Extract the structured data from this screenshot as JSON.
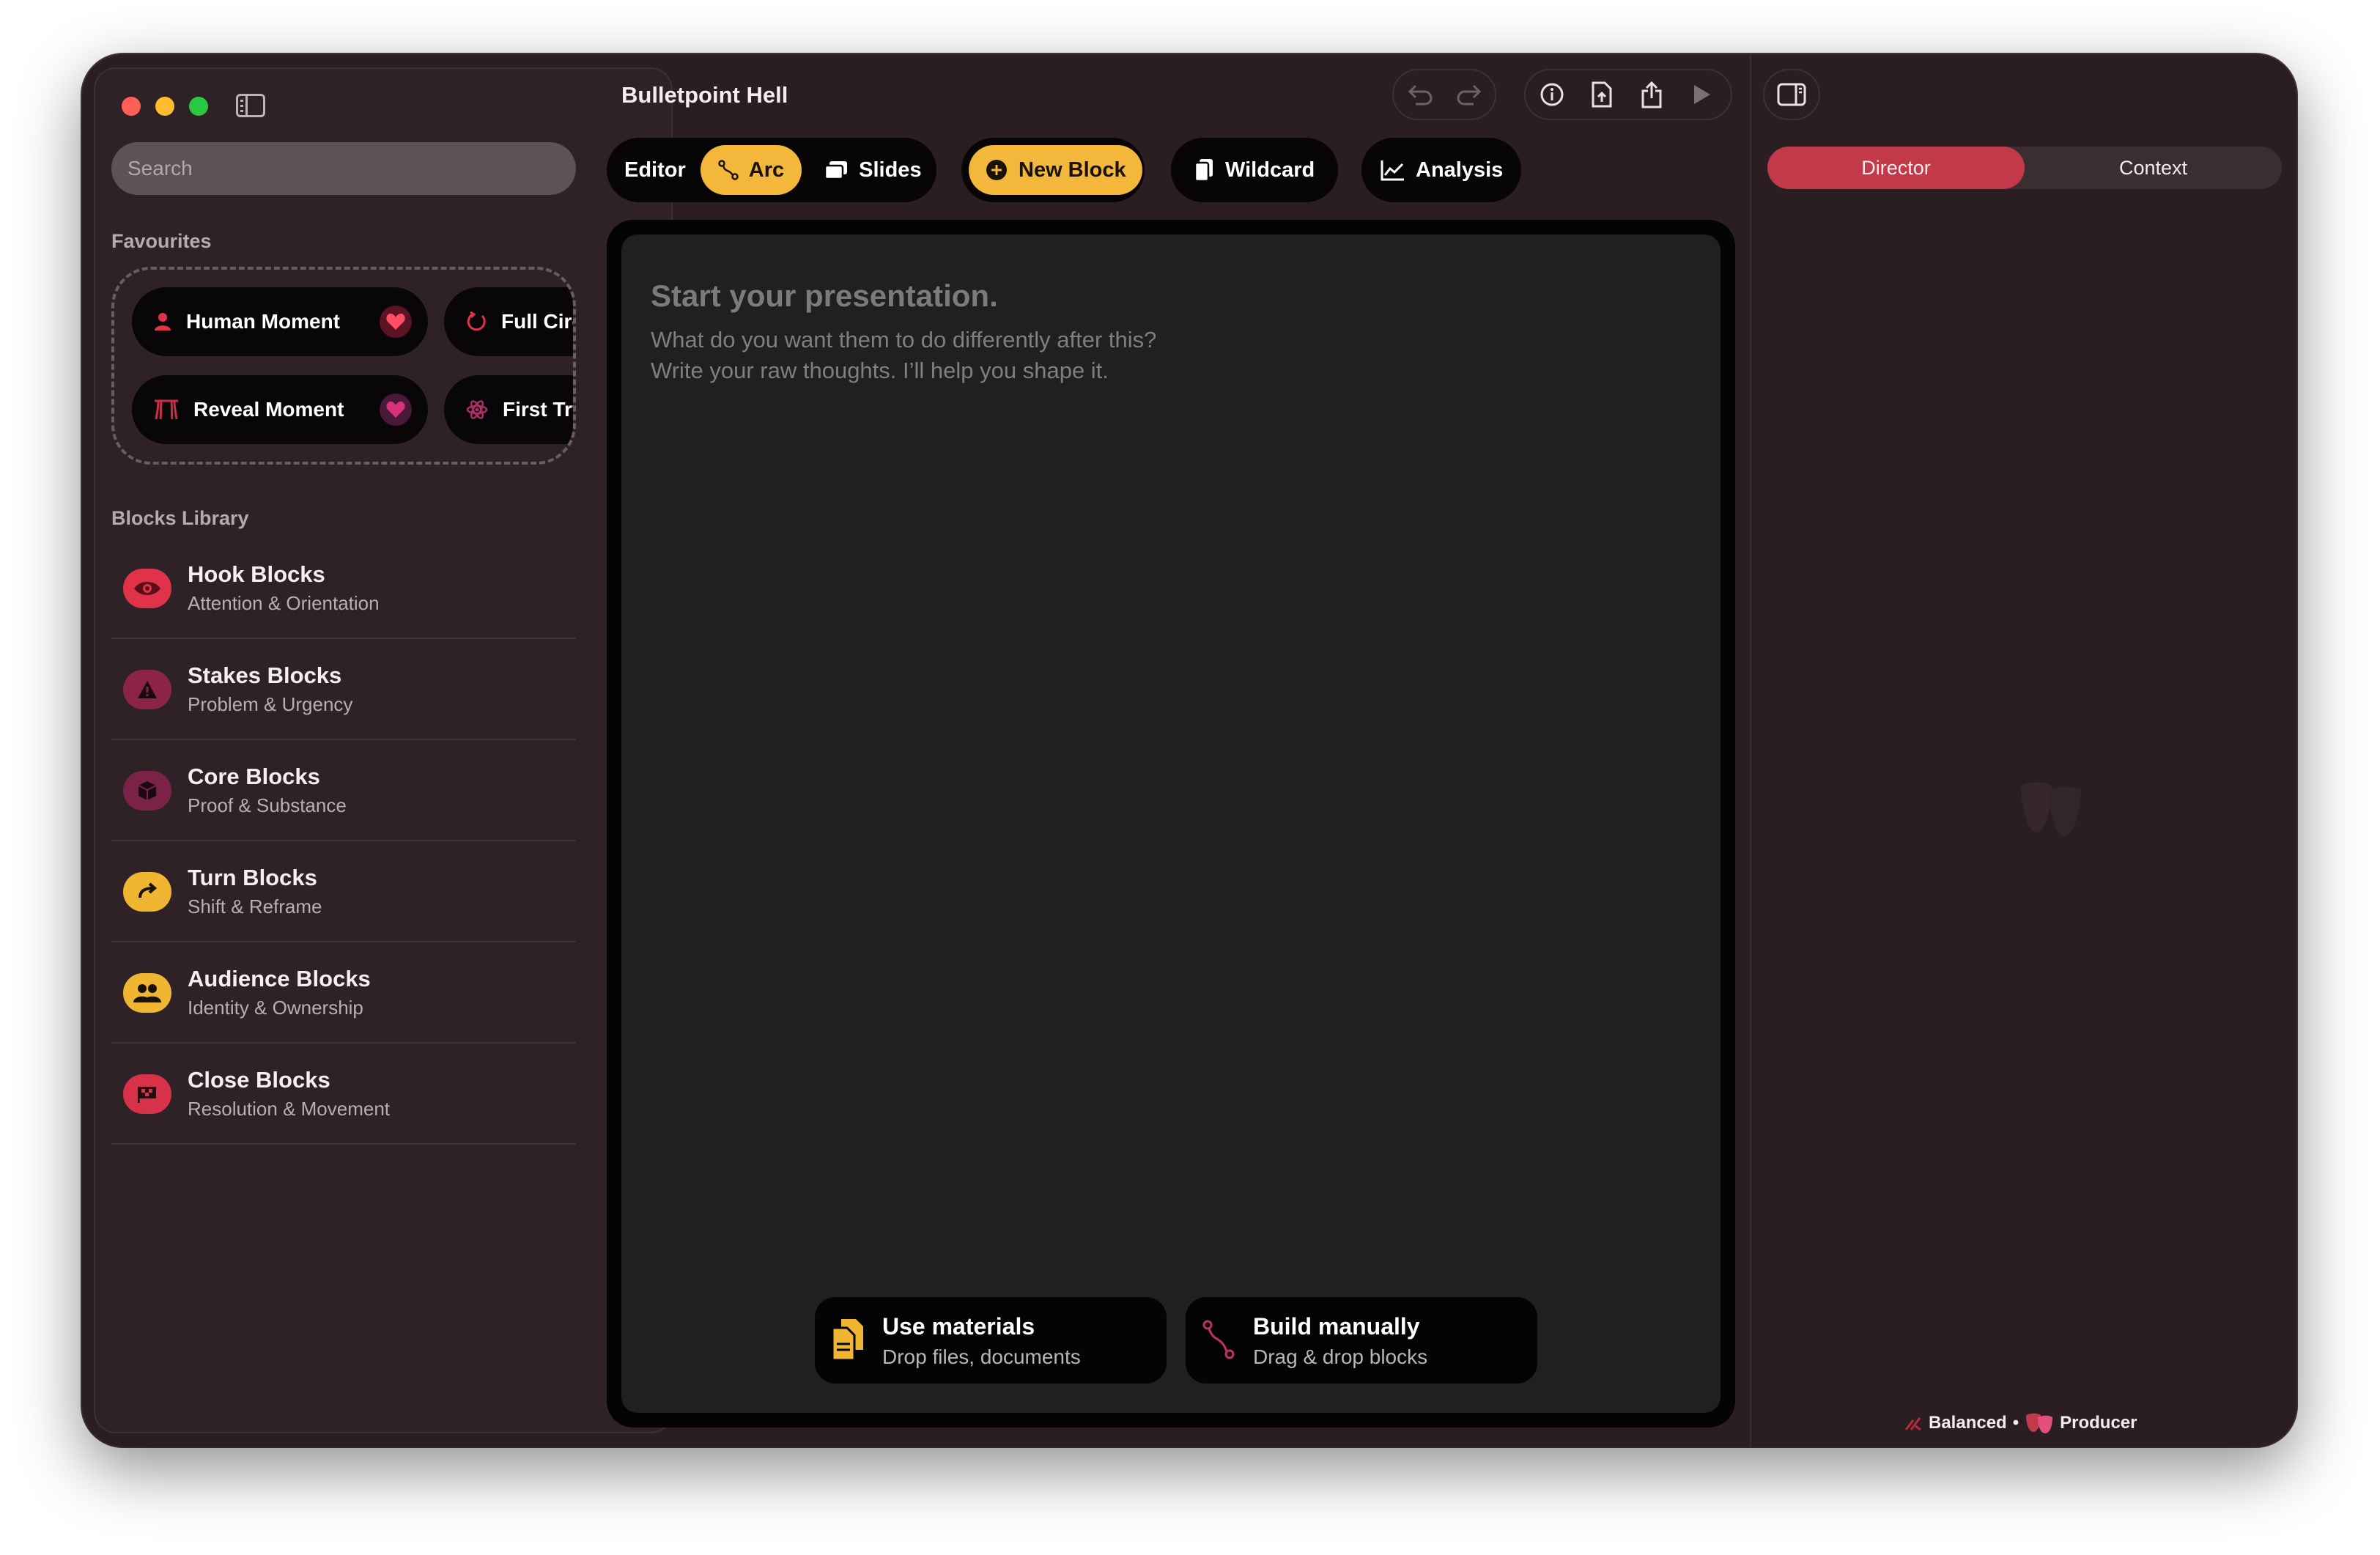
{
  "window": {
    "title": "Bulletpoint Hell"
  },
  "colors": {
    "accent_yellow": "#f2b73b",
    "accent_red": "#c23a4a",
    "hook": "#e0334a",
    "stakes": "#8c2448",
    "core": "#7a2248",
    "turn": "#f0b632",
    "audience": "#f0b632",
    "close": "#d8324a"
  },
  "sidebar": {
    "search_placeholder": "Search",
    "favourites_label": "Favourites",
    "favourites": [
      {
        "label": "Human Moment",
        "icon": "person-icon"
      },
      {
        "label": "Full Circle",
        "icon": "circle-arrow-icon"
      },
      {
        "label": "Reveal Moment",
        "icon": "curtain-icon"
      },
      {
        "label": "First Try",
        "icon": "atom-icon"
      }
    ],
    "library_label": "Blocks Library",
    "library": [
      {
        "title": "Hook Blocks",
        "subtitle": "Attention & Orientation",
        "icon": "eye-icon"
      },
      {
        "title": "Stakes Blocks",
        "subtitle": "Problem & Urgency",
        "icon": "warning-icon"
      },
      {
        "title": "Core Blocks",
        "subtitle": "Proof & Substance",
        "icon": "cube-icon"
      },
      {
        "title": "Turn Blocks",
        "subtitle": "Shift & Reframe",
        "icon": "turn-arrow-icon"
      },
      {
        "title": "Audience Blocks",
        "subtitle": "Identity & Ownership",
        "icon": "people-icon"
      },
      {
        "title": "Close Blocks",
        "subtitle": "Resolution & Movement",
        "icon": "flag-icon"
      }
    ]
  },
  "toolbar": {
    "editor_label": "Editor",
    "arc_label": "Arc",
    "slides_label": "Slides",
    "new_block_label": "New Block",
    "wildcard_label": "Wildcard",
    "analysis_label": "Analysis"
  },
  "editor": {
    "heading": "Start your presentation.",
    "line1": "What do you want them to do differently after this?",
    "line2": "Write your raw thoughts. I’ll help you shape it.",
    "use_materials_title": "Use materials",
    "use_materials_sub": "Drop files, documents",
    "build_manually_title": "Build manually",
    "build_manually_sub": "Drag & drop blocks"
  },
  "right_panel": {
    "tab_director": "Director",
    "tab_context": "Context",
    "footer_mode": "Balanced",
    "footer_separator": "•",
    "footer_role": "Producer"
  }
}
